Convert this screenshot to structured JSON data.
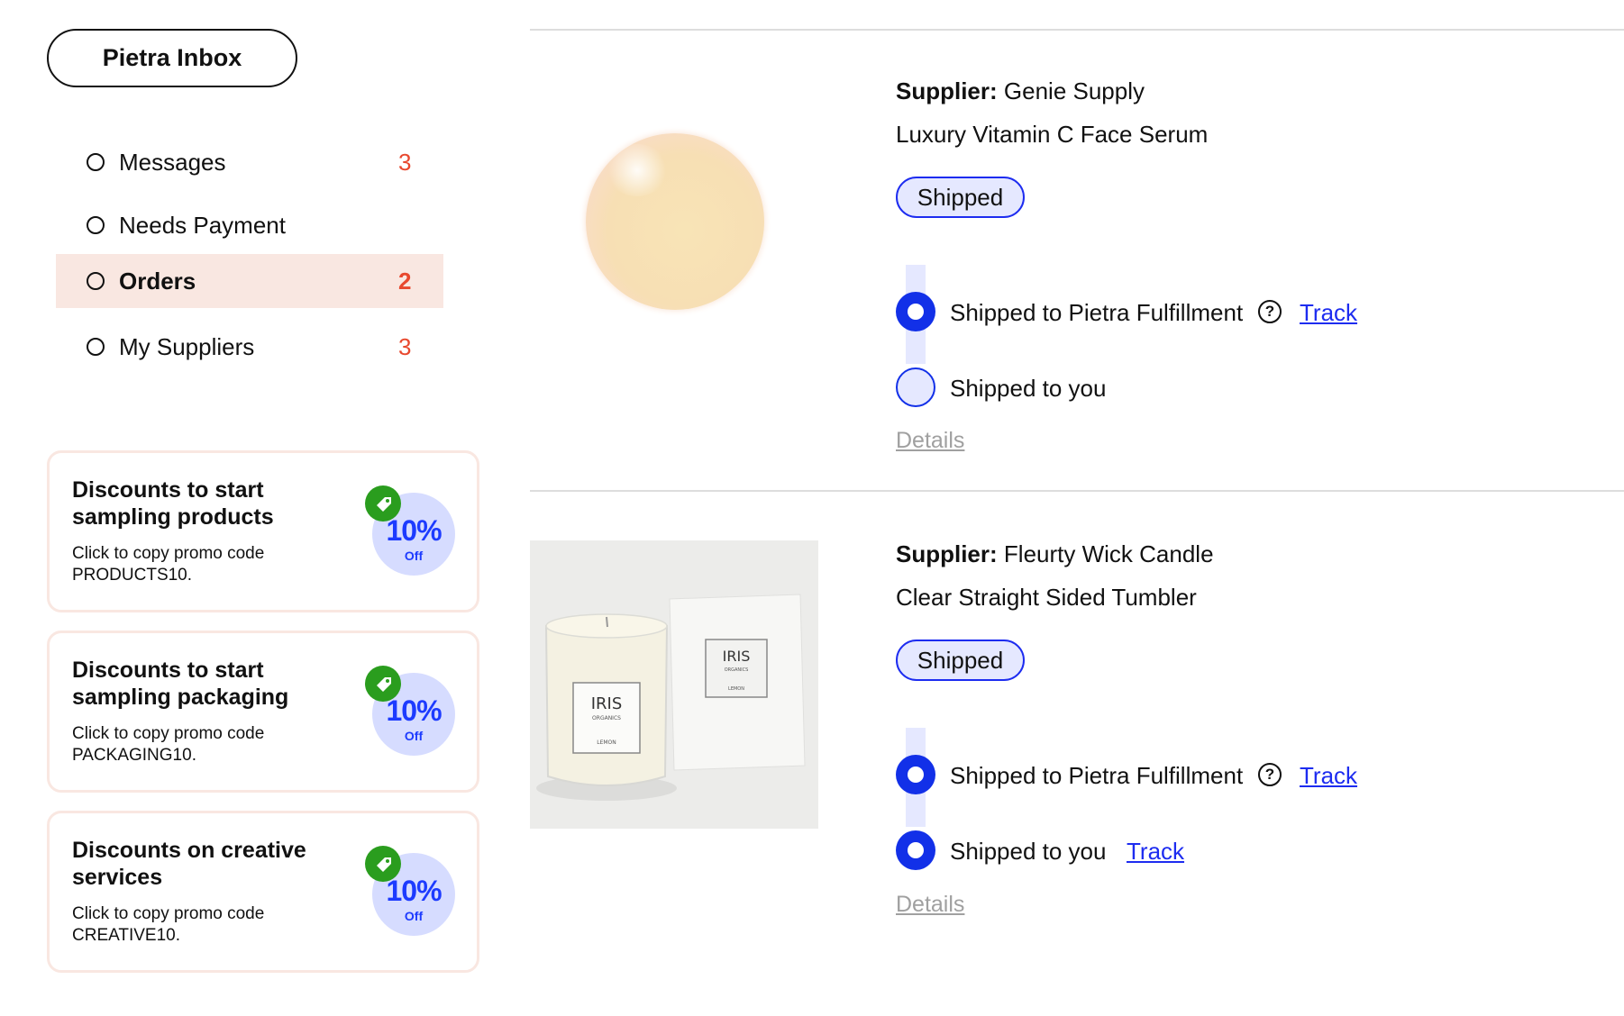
{
  "sidebar": {
    "inbox_button": "Pietra Inbox",
    "nav": [
      {
        "label": "Messages",
        "count": "3",
        "active": false
      },
      {
        "label": "Needs Payment",
        "count": "",
        "active": false
      },
      {
        "label": "Orders",
        "count": "2",
        "active": true
      },
      {
        "label": "My Suppliers",
        "count": "3",
        "active": false
      }
    ],
    "promos": [
      {
        "title": "Discounts to start sampling products",
        "body": "Click to copy promo code PRODUCTS10.",
        "badge_pct": "10%",
        "badge_off": "Off"
      },
      {
        "title": "Discounts to start sampling packaging",
        "body": "Click to copy promo code PACKAGING10.",
        "badge_pct": "10%",
        "badge_off": "Off"
      },
      {
        "title": "Discounts on creative services",
        "body": "Click to copy promo code CREATIVE10.",
        "badge_pct": "10%",
        "badge_off": "Off"
      }
    ]
  },
  "orders": [
    {
      "supplier_label": "Supplier:",
      "supplier": "Genie Supply",
      "product": "Luxury Vitamin C Face Serum",
      "status": "Shipped",
      "steps": [
        {
          "label": "Shipped to Pietra Fulfillment",
          "done": true,
          "track": "Track",
          "help_icon": "question-circle-icon"
        },
        {
          "label": "Shipped to you",
          "done": false,
          "track": ""
        }
      ],
      "details": "Details"
    },
    {
      "supplier_label": "Supplier:",
      "supplier": "Fleurty Wick Candle",
      "product": "Clear Straight Sided Tumbler",
      "status": "Shipped",
      "steps": [
        {
          "label": "Shipped to Pietra Fulfillment",
          "done": true,
          "track": "Track",
          "help_icon": "question-circle-icon"
        },
        {
          "label": "Shipped to you",
          "done": true,
          "track": "Track"
        }
      ],
      "details": "Details",
      "product_image": {
        "brand": "IRIS",
        "sub": "ORGANICS",
        "scent": "LEMON"
      }
    }
  ],
  "colors": {
    "accent_blue": "#1d2cf0",
    "active_nav_bg": "#f9e7e1",
    "count_red": "#e8482e",
    "badge_bg": "#d6dcff",
    "tag_green": "#2a9d1e"
  }
}
